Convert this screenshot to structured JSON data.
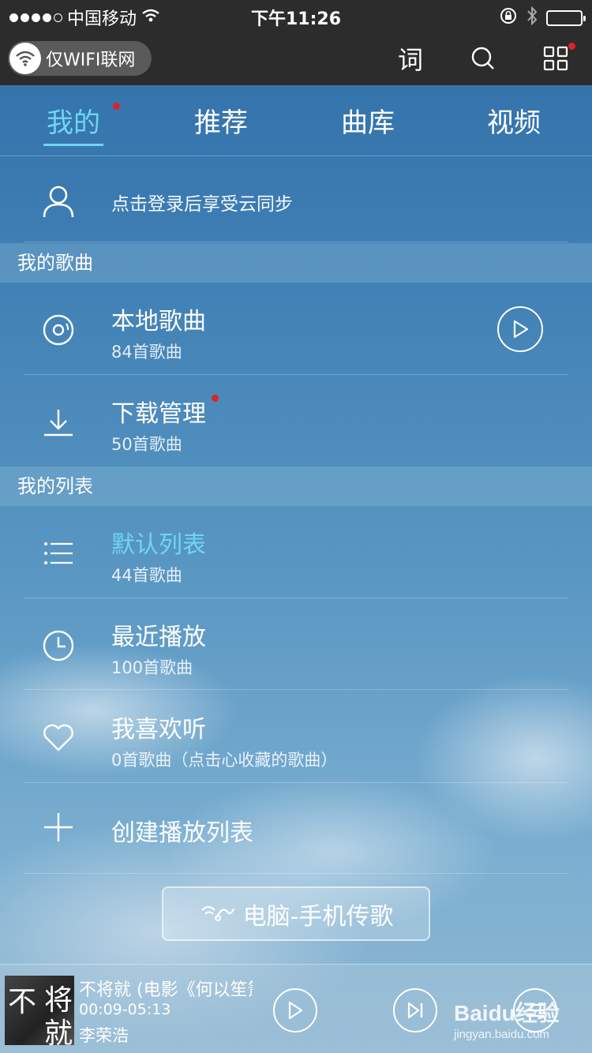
{
  "status_bar": {
    "carrier": "中国移动",
    "time": "下午11:26",
    "signal_dots": 5,
    "signal_filled": 4
  },
  "top_bar": {
    "wifi_only_label": "仅WIFI联网",
    "lyric_label": "词",
    "icons": [
      "wifi-icon",
      "search-icon",
      "grid-icon"
    ]
  },
  "tabs": [
    {
      "label": "我的",
      "active": true
    },
    {
      "label": "推荐",
      "active": false
    },
    {
      "label": "曲库",
      "active": false
    },
    {
      "label": "视频",
      "active": false
    }
  ],
  "login": {
    "text": "点击登录后享受云同步"
  },
  "my_songs": {
    "header": "我的歌曲",
    "items": [
      {
        "title": "本地歌曲",
        "subtitle": "84首歌曲",
        "icon": "disc-icon"
      },
      {
        "title": "下载管理",
        "subtitle": "50首歌曲",
        "icon": "download-icon"
      }
    ]
  },
  "my_lists": {
    "header": "我的列表",
    "items": [
      {
        "title": "默认列表",
        "subtitle": "44首歌曲",
        "icon": "list-icon"
      },
      {
        "title": "最近播放",
        "subtitle": "100首歌曲",
        "icon": "clock-icon"
      },
      {
        "title": "我喜欢听",
        "subtitle": "0首歌曲（点击心收藏的歌曲）",
        "icon": "heart-icon"
      }
    ],
    "create_label": "创建播放列表"
  },
  "transfer_button": {
    "label": "电脑-手机传歌"
  },
  "player": {
    "song_title": "不将就 (电影《何以笙箫默》主题曲)",
    "time": "00:09-05:13",
    "artist": "李荣浩",
    "album_chars": [
      "不",
      "将",
      "就"
    ]
  },
  "watermark": {
    "main": "Baidu经验",
    "sub": "jingyan.baidu.com"
  },
  "colors": {
    "accent": "#6fd6f2",
    "notification": "#e0202a",
    "bar": "#2c2c2c"
  }
}
